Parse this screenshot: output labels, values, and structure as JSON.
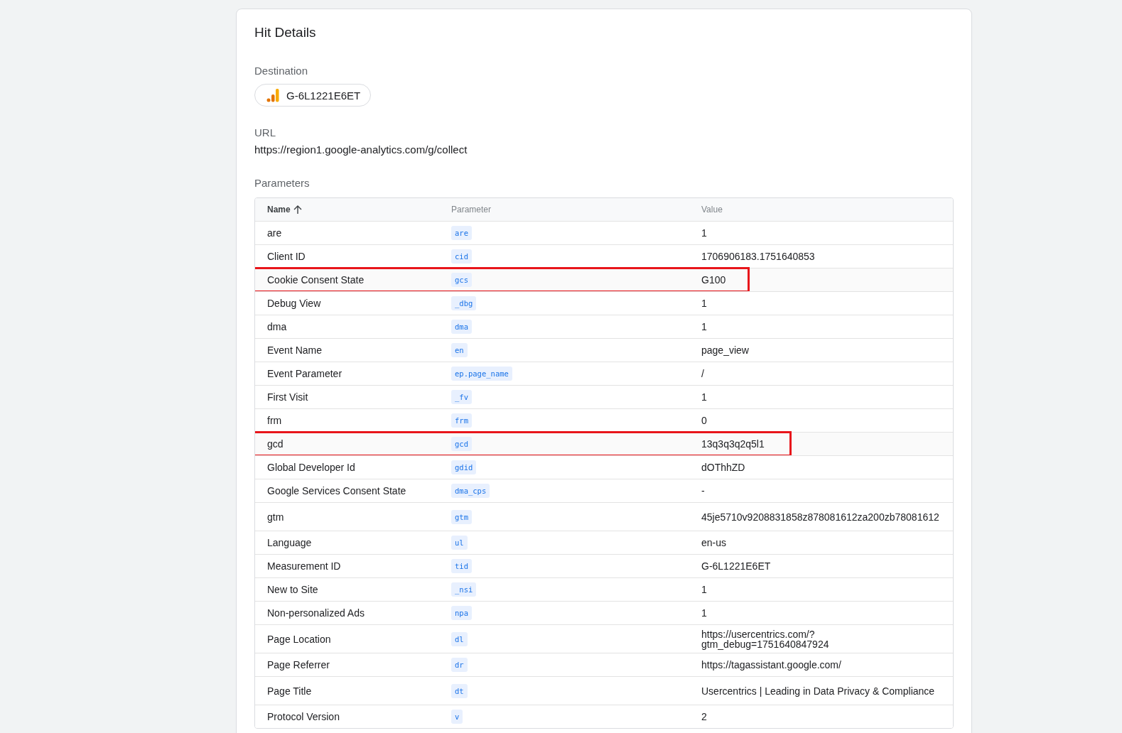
{
  "card": {
    "title": "Hit Details",
    "destination": {
      "label": "Destination",
      "tag": "G-6L1221E6ET"
    },
    "url": {
      "label": "URL",
      "value": "https://region1.google-analytics.com/g/collect"
    },
    "parameters": {
      "label": "Parameters",
      "columns": [
        {
          "label": "Name",
          "sorted": true
        },
        {
          "label": "Parameter",
          "sorted": false
        },
        {
          "label": "Value",
          "sorted": false
        }
      ],
      "rows": [
        {
          "name": "are",
          "param": "are",
          "value": "1",
          "highlighted": false
        },
        {
          "name": "Client ID",
          "param": "cid",
          "value": "1706906183.1751640853",
          "highlighted": false
        },
        {
          "name": "Cookie Consent State",
          "param": "gcs",
          "value": "G100",
          "highlighted": true
        },
        {
          "name": "Debug View",
          "param": "_dbg",
          "value": "1",
          "highlighted": false
        },
        {
          "name": "dma",
          "param": "dma",
          "value": "1",
          "highlighted": false
        },
        {
          "name": "Event Name",
          "param": "en",
          "value": "page_view",
          "highlighted": false
        },
        {
          "name": "Event Parameter",
          "param": "ep.page_name",
          "value": "/",
          "highlighted": false
        },
        {
          "name": "First Visit",
          "param": "_fv",
          "value": "1",
          "highlighted": false
        },
        {
          "name": "frm",
          "param": "frm",
          "value": "0",
          "highlighted": false
        },
        {
          "name": "gcd",
          "param": "gcd",
          "value": "13q3q3q2q5l1",
          "highlighted": true
        },
        {
          "name": "Global Developer Id",
          "param": "gdid",
          "value": "dOThhZD",
          "highlighted": false
        },
        {
          "name": "Google Services Consent State",
          "param": "dma_cps",
          "value": "-",
          "highlighted": false
        },
        {
          "name": "gtm",
          "param": "gtm",
          "value": "45je5710v9208831858z878081612za200zb78081612",
          "highlighted": false
        },
        {
          "name": "Language",
          "param": "ul",
          "value": "en-us",
          "highlighted": false
        },
        {
          "name": "Measurement ID",
          "param": "tid",
          "value": "G-6L1221E6ET",
          "highlighted": false
        },
        {
          "name": "New to Site",
          "param": "_nsi",
          "value": "1",
          "highlighted": false
        },
        {
          "name": "Non-personalized Ads",
          "param": "npa",
          "value": "1",
          "highlighted": false
        },
        {
          "name": "Page Location",
          "param": "dl",
          "value": "https://usercentrics.com/?gtm_debug=1751640847924",
          "highlighted": false
        },
        {
          "name": "Page Referrer",
          "param": "dr",
          "value": "https://tagassistant.google.com/",
          "highlighted": false
        },
        {
          "name": "Page Title",
          "param": "dt",
          "value": "Usercentrics | Leading in Data Privacy & Compliance",
          "highlighted": false
        },
        {
          "name": "Protocol Version",
          "param": "v",
          "value": "2",
          "highlighted": false
        }
      ]
    }
  }
}
